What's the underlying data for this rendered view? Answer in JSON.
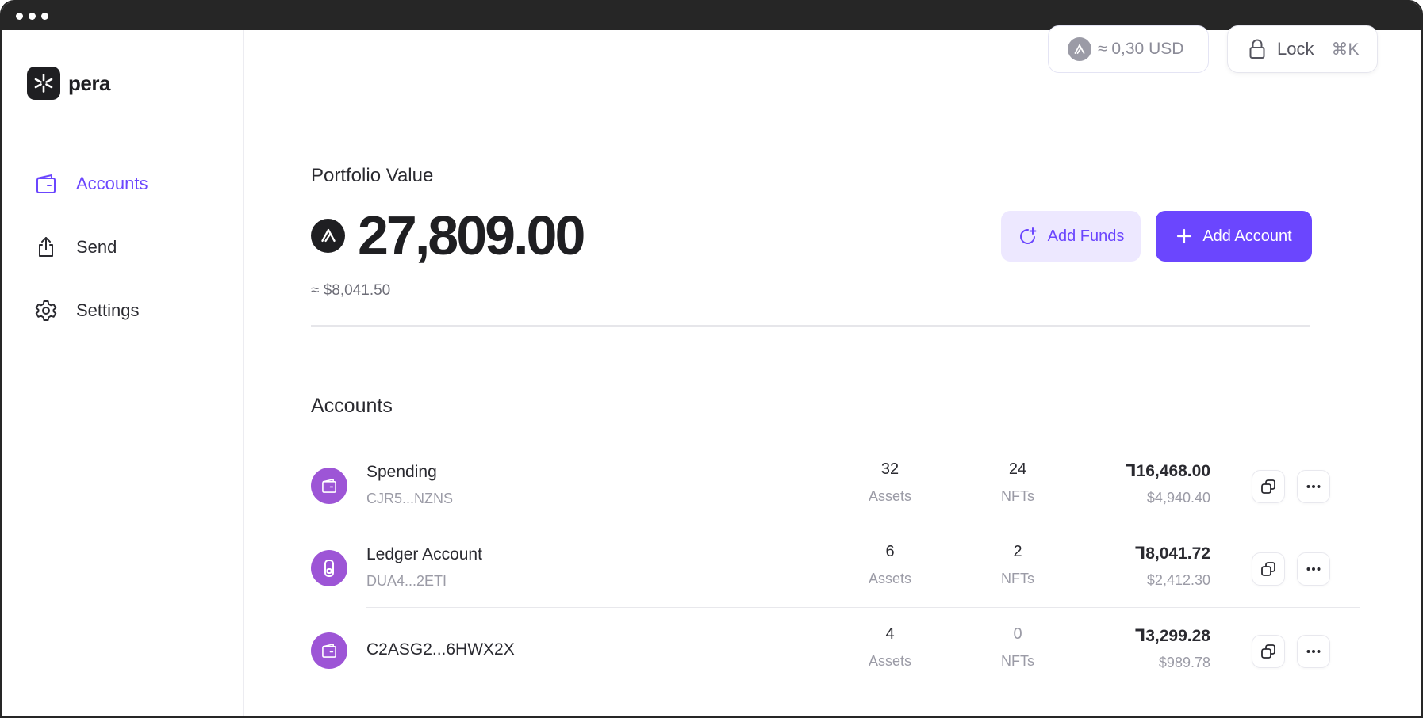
{
  "brand": {
    "name": "pera"
  },
  "sidebar": {
    "items": [
      {
        "label": "Accounts",
        "icon": "wallet-icon",
        "active": true
      },
      {
        "label": "Send",
        "icon": "share-upload-icon",
        "active": false
      },
      {
        "label": "Settings",
        "icon": "gear-icon",
        "active": false
      }
    ]
  },
  "topbar": {
    "price": "≈ 0,30 USD",
    "lock_label": "Lock",
    "lock_shortcut": "⌘K"
  },
  "portfolio": {
    "label": "Portfolio Value",
    "value": "27,809.00",
    "usd": "≈ $8,041.50"
  },
  "actions": {
    "add_funds": "Add Funds",
    "add_account": "Add Account"
  },
  "accounts": {
    "title": "Accounts",
    "rows": [
      {
        "name": "Spending",
        "address": "CJR5...NZNS",
        "assets": "32",
        "assets_label": "Assets",
        "nfts": "24",
        "nfts_label": "NFTs",
        "amount": "Ꞁ16,468.00",
        "usd": "$4,940.40",
        "icon": "wallet-icon"
      },
      {
        "name": "Ledger Account",
        "address": "DUA4...2ETI",
        "assets": "6",
        "assets_label": "Assets",
        "nfts": "2",
        "nfts_label": "NFTs",
        "amount": "Ꞁ8,041.72",
        "usd": "$2,412.30",
        "icon": "ledger-icon"
      },
      {
        "name": "C2ASG2...6HWX2X",
        "address": "",
        "assets": "4",
        "assets_label": "Assets",
        "nfts": "0",
        "nfts_label": "NFTs",
        "amount": "Ꞁ3,299.28",
        "usd": "$989.78",
        "icon": "wallet-icon"
      }
    ]
  },
  "colors": {
    "accent": "#6b46fe",
    "accent_light": "#ede8ff",
    "avatar": "#9d55d6",
    "titlebar": "#262626"
  }
}
